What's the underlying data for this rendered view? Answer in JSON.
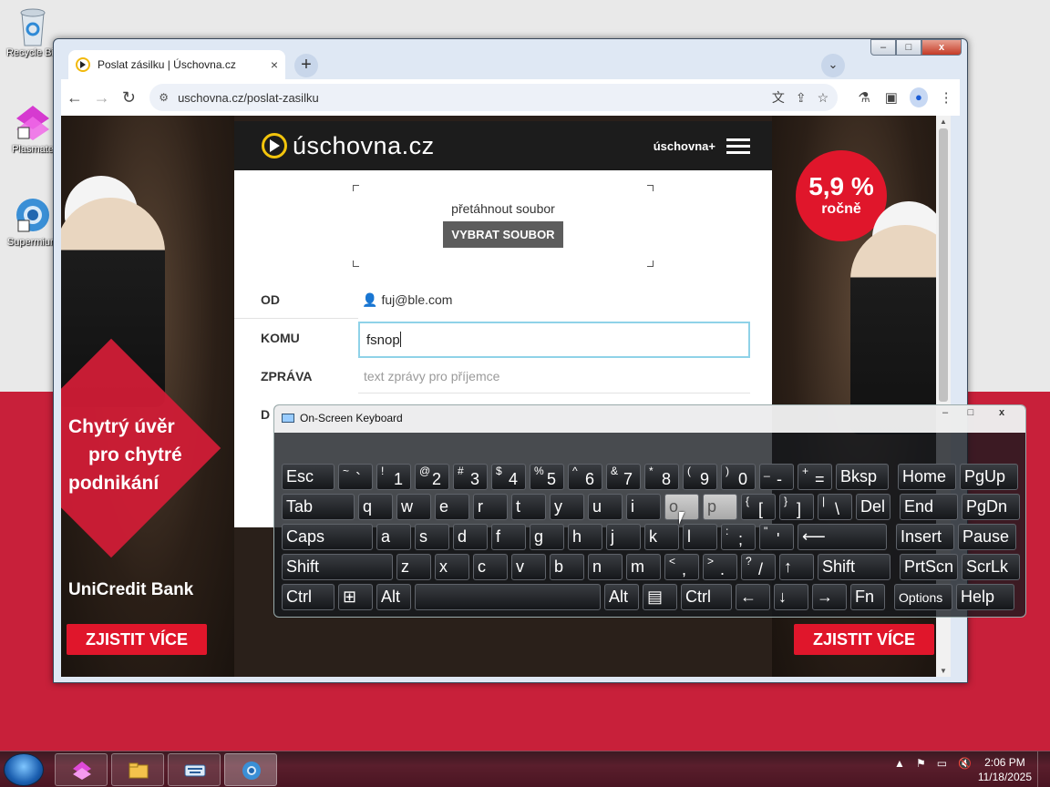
{
  "desktop": {
    "icons": [
      {
        "label": "Recycle Bin"
      },
      {
        "label": "Plasmate"
      },
      {
        "label": "Supermium"
      }
    ]
  },
  "browser": {
    "tab_title": "Poslat zásilku | Úschovna.cz",
    "tab_close": "×",
    "new_tab": "+",
    "tab_search": "⌄",
    "url": "uschovna.cz/poslat-zasilku",
    "window_controls": {
      "min": "–",
      "max": "□",
      "close": "x"
    }
  },
  "site": {
    "logo": "úschovna.cz",
    "menu_label": "úschovna+",
    "drop_hint": "přetáhnout soubor",
    "pick_button": "VYBRAT SOUBOR",
    "form": {
      "from_label": "OD",
      "from_value": "fuj@ble.com",
      "to_label": "KOMU",
      "to_value": "fsnop",
      "message_label": "ZPRÁVA",
      "message_placeholder": "text zprávy pro příjemce",
      "partial_label": "D"
    }
  },
  "ads": {
    "left": {
      "headline": [
        "Chytrý úvěr",
        "pro chytré",
        "podnikání"
      ],
      "bank": "UniCredit Bank",
      "cta": "ZJISTIT VÍCE"
    },
    "right": {
      "badge_value": "5,9 %",
      "badge_sub": "ročně",
      "cta": "ZJISTIT VÍCE"
    }
  },
  "osk": {
    "title": "On-Screen Keyboard",
    "controls": {
      "min": "–",
      "max": "□",
      "close": "x"
    },
    "rows": [
      [
        {
          "label": "Esc"
        },
        {
          "top": "~",
          "label": "`"
        },
        {
          "top": "!",
          "label": "1"
        },
        {
          "top": "@",
          "label": "2"
        },
        {
          "top": "#",
          "label": "3"
        },
        {
          "top": "$",
          "label": "4"
        },
        {
          "top": "%",
          "label": "5"
        },
        {
          "top": "^",
          "label": "6"
        },
        {
          "top": "&",
          "label": "7"
        },
        {
          "top": "*",
          "label": "8"
        },
        {
          "top": "(",
          "label": "9"
        },
        {
          "top": ")",
          "label": "0"
        },
        {
          "top": "_",
          "label": "-"
        },
        {
          "top": "+",
          "label": "="
        },
        {
          "label": "Bksp"
        },
        {
          "label": "Home"
        },
        {
          "label": "PgUp"
        }
      ],
      [
        {
          "label": "Tab"
        },
        {
          "label": "q"
        },
        {
          "label": "w"
        },
        {
          "label": "e"
        },
        {
          "label": "r"
        },
        {
          "label": "t"
        },
        {
          "label": "y"
        },
        {
          "label": "u"
        },
        {
          "label": "i"
        },
        {
          "label": "o"
        },
        {
          "label": "p"
        },
        {
          "top": "{",
          "label": "["
        },
        {
          "top": "}",
          "label": "]"
        },
        {
          "top": "|",
          "label": "\\"
        },
        {
          "label": "Del"
        },
        {
          "label": "End"
        },
        {
          "label": "PgDn"
        }
      ],
      [
        {
          "label": "Caps"
        },
        {
          "label": "a"
        },
        {
          "label": "s"
        },
        {
          "label": "d"
        },
        {
          "label": "f"
        },
        {
          "label": "g"
        },
        {
          "label": "h"
        },
        {
          "label": "j"
        },
        {
          "label": "k"
        },
        {
          "label": "l"
        },
        {
          "top": ":",
          "label": ";"
        },
        {
          "top": "\"",
          "label": "'"
        },
        {
          "label": "⟵"
        },
        {
          "label": "Insert"
        },
        {
          "label": "Pause"
        }
      ],
      [
        {
          "label": "Shift"
        },
        {
          "label": "z"
        },
        {
          "label": "x"
        },
        {
          "label": "c"
        },
        {
          "label": "v"
        },
        {
          "label": "b"
        },
        {
          "label": "n"
        },
        {
          "label": "m"
        },
        {
          "top": "<",
          "label": ","
        },
        {
          "top": ">",
          "label": "."
        },
        {
          "top": "?",
          "label": "/"
        },
        {
          "label": "↑"
        },
        {
          "label": "Shift"
        },
        {
          "label": "PrtScn"
        },
        {
          "label": "ScrLk"
        }
      ],
      [
        {
          "label": "Ctrl"
        },
        {
          "label": "⊞"
        },
        {
          "label": "Alt"
        },
        {
          "label": ""
        },
        {
          "label": "Alt"
        },
        {
          "label": "▤"
        },
        {
          "label": "Ctrl"
        },
        {
          "label": "←"
        },
        {
          "label": "↓"
        },
        {
          "label": "→"
        },
        {
          "label": "Fn"
        },
        {
          "label": "Options"
        },
        {
          "label": "Help"
        }
      ]
    ]
  },
  "taskbar": {
    "clock_time": "2:06 PM",
    "clock_date": "11/18/2025"
  }
}
